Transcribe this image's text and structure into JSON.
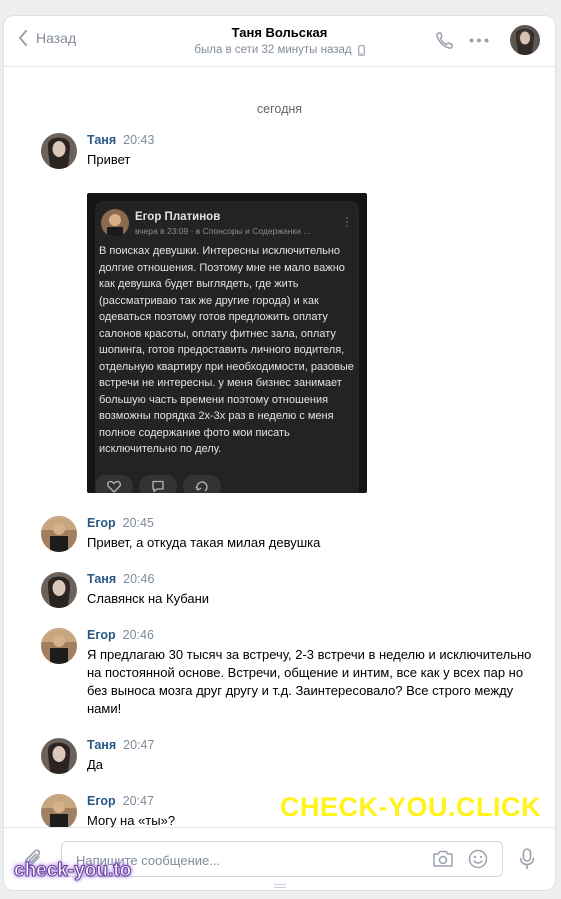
{
  "header": {
    "back_label": "Назад",
    "title": "Таня Вольская",
    "status": "была в сети 32 минуты назад"
  },
  "date_separator": "сегодня",
  "messages": [
    {
      "name": "Таня",
      "time": "20:43",
      "text": "Привет"
    },
    {
      "name": "Егор",
      "time": "20:45",
      "text": "Привет, а откуда такая милая девушка"
    },
    {
      "name": "Таня",
      "time": "20:46",
      "text": "Славянск на Кубани"
    },
    {
      "name": "Егор",
      "time": "20:46",
      "text": "Я предлагаю 30 тысяч за встречу, 2-3 встречи в неделю и исключительно на постоянной основе. Встречи, общение и интим, все как у всех пар но без выноса мозга друг другу и т.д. Заинтересовало? Все строго между нами!"
    },
    {
      "name": "Таня",
      "time": "20:47",
      "text": "Да"
    },
    {
      "name": "Егор",
      "time": "20:47",
      "text": "Могу на «ты»?"
    }
  ],
  "post": {
    "author": "Егор Платинов",
    "meta": "вчера в 23:09 · в Спонсоры и Содержанки ...",
    "text": "В поисках девушки. Интересны исключительно долгие отношения. Поэтому мне не мало важно как девушка будет выглядеть, где жить (рассматриваю так же другие города) и как одеваться поэтому готов предложить оплату салонов красоты, оплату фитнес зала, оплату шопинга, готов предоставить личного водителя, отдельную квартиру при необходимости, разовые встречи не интересны. у меня бизнес занимает большую часть времени поэтому отношения возможны порядка 2х-3х раз в неделю с меня полное содержание фото мои писать исключительно по делу."
  },
  "composer": {
    "placeholder": "Напишите сообщение..."
  },
  "watermarks": {
    "big": "CHECK-YOU.CLICK",
    "small": "check-you.to"
  },
  "colors": {
    "name_link": "#2a5885",
    "muted": "#818c99",
    "watermark_yellow": "#fff31a"
  }
}
